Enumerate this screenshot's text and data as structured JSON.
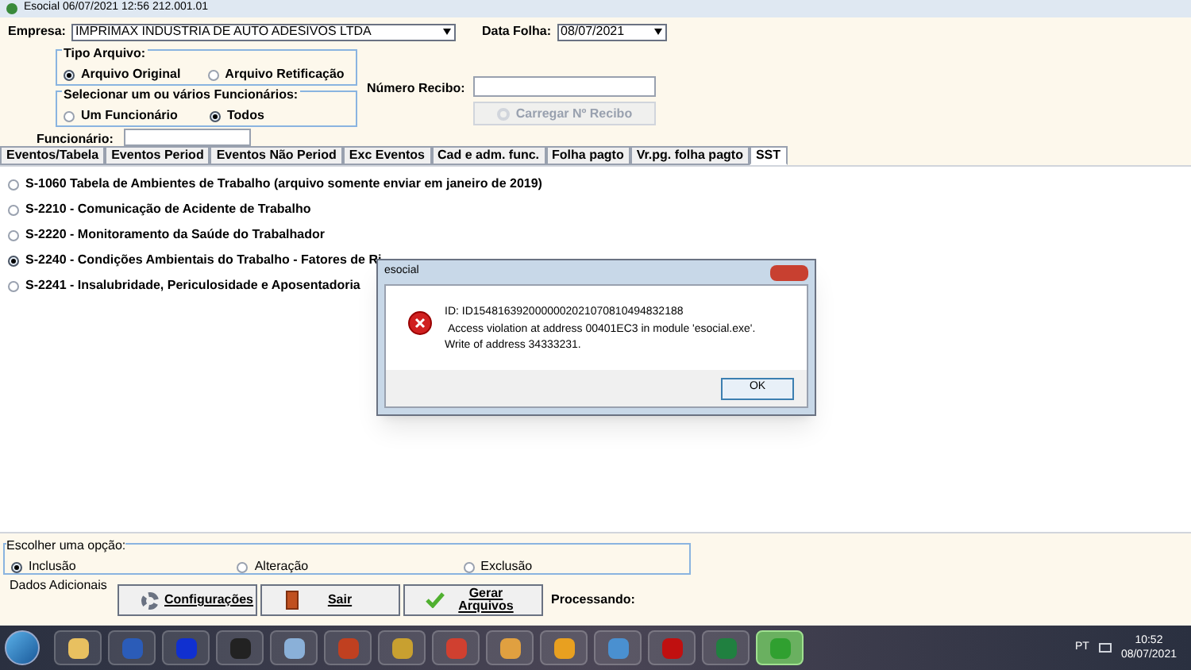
{
  "window": {
    "title": "Esocial 06/07/2021 12:56 212.001.01"
  },
  "header": {
    "empresa_label": "Empresa:",
    "empresa_value": "IMPRIMAX INDUSTRIA DE AUTO ADESIVOS LTDA",
    "data_label": "Data Folha:",
    "data_value": "08/07/2021",
    "tipo_arquivo": {
      "title": "Tipo Arquivo:",
      "options": [
        {
          "label": "Arquivo Original",
          "selected": true
        },
        {
          "label": "Arquivo Retificação",
          "selected": false
        }
      ]
    },
    "funcionarios": {
      "title": "Selecionar um ou vários Funcionários:",
      "options": [
        {
          "label": "Um Funcionário",
          "selected": false
        },
        {
          "label": "Todos",
          "selected": true
        }
      ]
    },
    "recibo_label": "Número Recibo:",
    "carregar_button": {
      "label": "Carregar Nº Recibo",
      "disabled": true
    },
    "funcionario_label": "Funcionário:"
  },
  "tabs": [
    {
      "label": "Eventos/Tabela",
      "selected": false
    },
    {
      "label": "Eventos Period",
      "selected": false
    },
    {
      "label": "Eventos Não Period",
      "selected": false
    },
    {
      "label": "Exc Eventos",
      "selected": false
    },
    {
      "label": "Cad e adm. func.",
      "selected": false
    },
    {
      "label": "Folha pagto",
      "selected": false
    },
    {
      "label": "Vr.pg. folha pagto",
      "selected": false
    },
    {
      "label": "SST",
      "selected": true
    }
  ],
  "events": [
    {
      "label": "S-1060 Tabela de Ambientes de Trabalho (arquivo somente enviar em janeiro de 2019)",
      "selected": false
    },
    {
      "label": "S-2210 - Comunicação de Acidente de Trabalho",
      "selected": false
    },
    {
      "label": "S-2220 -  Monitoramento da Saúde do Trabalhador",
      "selected": false
    },
    {
      "label": "S-2240 -  Condições Ambientais do Trabalho - Fatores de Ri",
      "selected": true
    },
    {
      "label": "S-2241 - Insalubridade, Periculosidade e Aposentadoria",
      "selected": false
    }
  ],
  "options": {
    "title": "Escolher uma opção:",
    "items": [
      {
        "label": "Inclusão",
        "selected": true
      },
      {
        "label": "Alteração",
        "selected": false
      },
      {
        "label": "Exclusão",
        "selected": false
      }
    ]
  },
  "dados_label": "Dados Adicionais",
  "buttons": [
    {
      "kind": "gear",
      "label": "Configurações"
    },
    {
      "kind": "door",
      "label": "Sair"
    },
    {
      "kind": "check",
      "label": "Gerar Arquivos"
    }
  ],
  "processando_label": "Processando:",
  "dialog": {
    "title": "esocial",
    "id_line": "ID: ID1548163920000002021070810494832188",
    "message": " Access violation at address 00401EC3 in module 'esocial.exe'. Write of address 34333231.",
    "ok": "OK"
  },
  "taskbar": {
    "apps": [
      {
        "selected": false
      },
      {
        "selected": false
      },
      {
        "selected": false
      },
      {
        "selected": false
      },
      {
        "selected": false
      },
      {
        "selected": false
      },
      {
        "selected": false
      },
      {
        "selected": false
      },
      {
        "selected": false
      },
      {
        "selected": false
      },
      {
        "selected": false
      },
      {
        "selected": false
      },
      {
        "selected": false
      },
      {
        "selected": true
      }
    ],
    "language": "PT",
    "time": "10:52",
    "date": "08/07/2021"
  }
}
